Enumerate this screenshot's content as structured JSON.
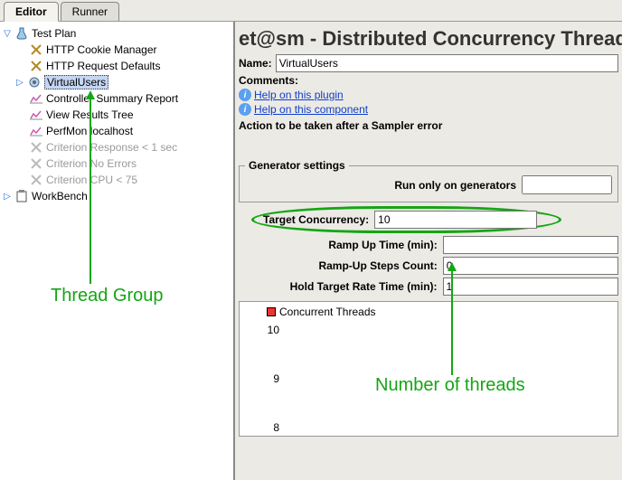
{
  "tabs": {
    "editor": "Editor",
    "runner": "Runner"
  },
  "tree": {
    "testPlan": "Test Plan",
    "cookieManager": "HTTP Cookie Manager",
    "requestDefaults": "HTTP Request Defaults",
    "virtualUsers": "VirtualUsers",
    "summaryReport": "Controller Summary Report",
    "resultsTree": "View Results Tree",
    "perfmon": "PerfMon localhost",
    "critResponse": "Criterion Response < 1 sec",
    "critNoErrors": "Criterion No Errors",
    "critCPU": "Criterion CPU < 75",
    "workbench": "WorkBench"
  },
  "panel": {
    "title": "et@sm - Distributed Concurrency Thread Group",
    "nameLabel": "Name:",
    "nameValue": "VirtualUsers",
    "commentsLabel": "Comments:",
    "helpPlugin": "Help on this plugin",
    "helpComponent": "Help on this component",
    "actionLabel": "Action to be taken after a Sampler error",
    "generatorLegend": "Generator settings",
    "runOnly": "Run only on generators",
    "targetConcurrencyLabel": "Target Concurrency:",
    "targetConcurrencyValue": "10",
    "rampUpTimeLabel": "Ramp Up Time (min):",
    "rampUpTimeValue": "",
    "rampUpStepsLabel": "Ramp-Up Steps Count:",
    "rampUpStepsValue": "0",
    "holdRateLabel": "Hold Target Rate Time (min):",
    "holdRateValue": "1",
    "chartLegend": "Concurrent Threads"
  },
  "annotations": {
    "threadGroup": "Thread Group",
    "numThreads": "Number of threads"
  },
  "chart_data": {
    "type": "line",
    "title": "Concurrent Threads",
    "xlabel": "",
    "ylabel": "",
    "ylim": [
      8,
      10
    ],
    "yticks": [
      8,
      9,
      10
    ],
    "series": [
      {
        "name": "Concurrent Threads",
        "values": []
      }
    ]
  }
}
